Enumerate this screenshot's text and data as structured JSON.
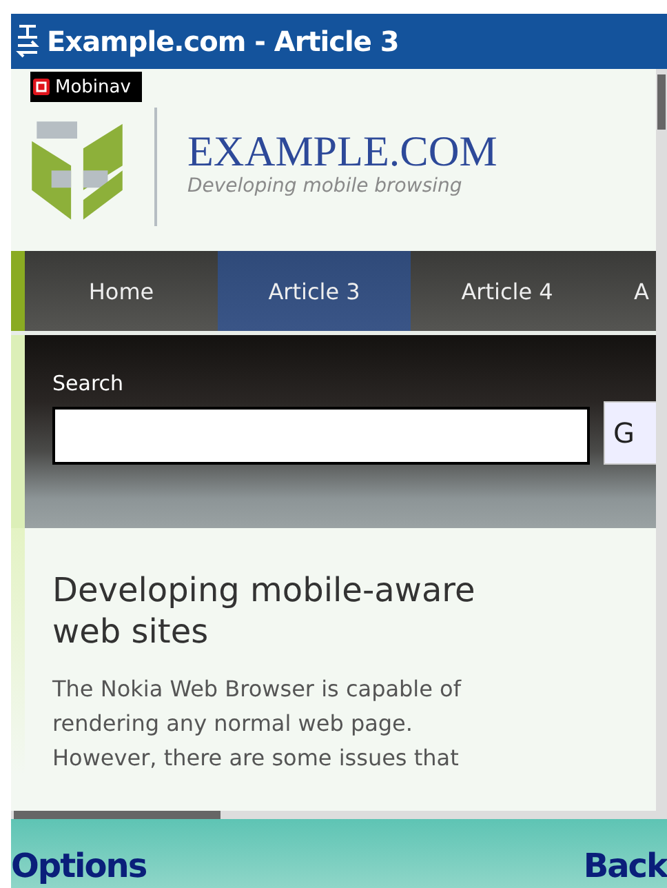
{
  "window": {
    "title": "Example.com - Article 3"
  },
  "badge": {
    "label": "Mobinav"
  },
  "site": {
    "name": "EXAMPLE.COM",
    "tagline": "Developing mobile browsing"
  },
  "tabs": [
    {
      "label": "Home",
      "selected": false
    },
    {
      "label": "Article 3",
      "selected": true
    },
    {
      "label": "Article 4",
      "selected": false
    },
    {
      "label": "A",
      "selected": false
    }
  ],
  "search": {
    "label": "Search",
    "button": "G"
  },
  "article": {
    "heading": "Developing mobile-aware web sites",
    "body": "The Nokia Web Browser is capable of rendering any normal web page. However, there are some issues that"
  },
  "softkeys": {
    "left": "Options",
    "right": "Back"
  }
}
